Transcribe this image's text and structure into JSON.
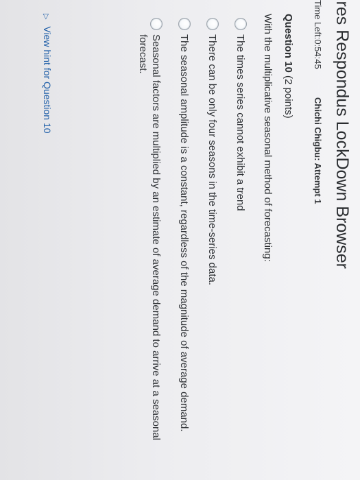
{
  "window": {
    "title": "ires Respondus LockDown Browser"
  },
  "status": {
    "time_left": "Time Left:0:54:45",
    "user_attempt": "Chichi Chigbu: Attempt 1"
  },
  "question": {
    "number_label": "Question 10",
    "points": "(2 points)",
    "prompt": "With the multiplicative seasonal method of forecasting:",
    "options": [
      "The times series cannot exhibit a trend",
      "There can be only four seasons in the time-series data.",
      "The seasonal amplitude is a constant, regardless of the magnitude of average demand.",
      "Seasonal factors are multiplied by an estimate of average demand to arrive at a seasonal forecast."
    ],
    "hint_label": "View hint for Question 10"
  },
  "icons": {
    "hint": "triangle-right-icon",
    "option": "radio-icon"
  },
  "colors": {
    "link": "#1f5fa8",
    "text": "#2f3235",
    "background": "#eeeef0"
  }
}
